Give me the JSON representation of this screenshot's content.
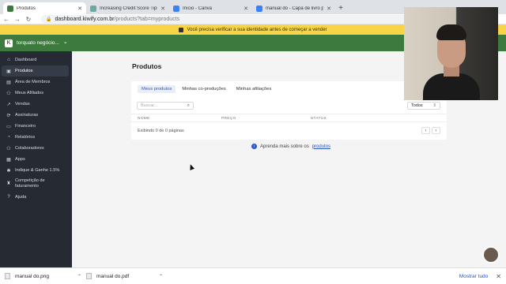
{
  "browser": {
    "tabs": [
      {
        "title": "Produtos",
        "favicon_color": "#3c7a3e",
        "active": true
      },
      {
        "title": "Increasing Credit Score Tips",
        "favicon_color": "#6fa8a0",
        "active": false
      },
      {
        "title": "Início - Canva",
        "favicon_color": "#3b82f6",
        "active": false
      },
      {
        "title": "manual do - Capa de livro para",
        "favicon_color": "#3b82f6",
        "active": false
      }
    ],
    "new_tab": "+",
    "url_host": "dashboard.kiwify.com.br",
    "url_path": "/products?tab=myproducts"
  },
  "notice": {
    "text": "Você precisa verificar a sua identidade antes de começar a vender"
  },
  "header": {
    "logo_letter": "K",
    "store_name": "torquato negócio...",
    "chevron": "⌄"
  },
  "sidebar": {
    "items": [
      {
        "label": "Dashboard",
        "icon": "home-icon",
        "glyph": "⌂"
      },
      {
        "label": "Produtos",
        "icon": "box-icon",
        "glyph": "▣",
        "active": true
      },
      {
        "label": "Área de Membros",
        "icon": "members-icon",
        "glyph": "▤"
      },
      {
        "label": "Meus Afiliados",
        "icon": "users-icon",
        "glyph": "⚇"
      },
      {
        "label": "Vendas",
        "icon": "chart-icon",
        "glyph": "↗"
      },
      {
        "label": "Assinaturas",
        "icon": "subscription-icon",
        "glyph": "⟳"
      },
      {
        "label": "Financeiro",
        "icon": "money-icon",
        "glyph": "▭"
      },
      {
        "label": "Relatórios",
        "icon": "report-icon",
        "glyph": "◔"
      },
      {
        "label": "Colaboradores",
        "icon": "collaborators-icon",
        "glyph": "⚇"
      },
      {
        "label": "Apps",
        "icon": "apps-icon",
        "glyph": "▦"
      },
      {
        "label": "Indique & Ganhe 1.5%",
        "icon": "gift-icon",
        "glyph": "✱"
      },
      {
        "label": "Competição de faturamento",
        "icon": "trophy-icon",
        "glyph": "♜"
      },
      {
        "label": "Ajuda",
        "icon": "help-icon",
        "glyph": "?"
      }
    ]
  },
  "main": {
    "title": "Produtos",
    "tabs": [
      {
        "label": "Meus produtos",
        "active": true
      },
      {
        "label": "Minhas co-produções",
        "active": false
      },
      {
        "label": "Minhas afiliações",
        "active": false
      }
    ],
    "search_placeholder": "Buscar...",
    "filter_value": "Todos",
    "columns": [
      "NOME",
      "PREÇO",
      "STATUS"
    ],
    "pagination_text": "Exibindo 0 de 0 páginas",
    "learn_prefix": "Aprenda mais sobre os",
    "learn_link": "produtos"
  },
  "downloads": {
    "files": [
      {
        "name": "manual do.png"
      },
      {
        "name": "manual do.pdf"
      }
    ],
    "show_all": "Mostrar tudo"
  }
}
